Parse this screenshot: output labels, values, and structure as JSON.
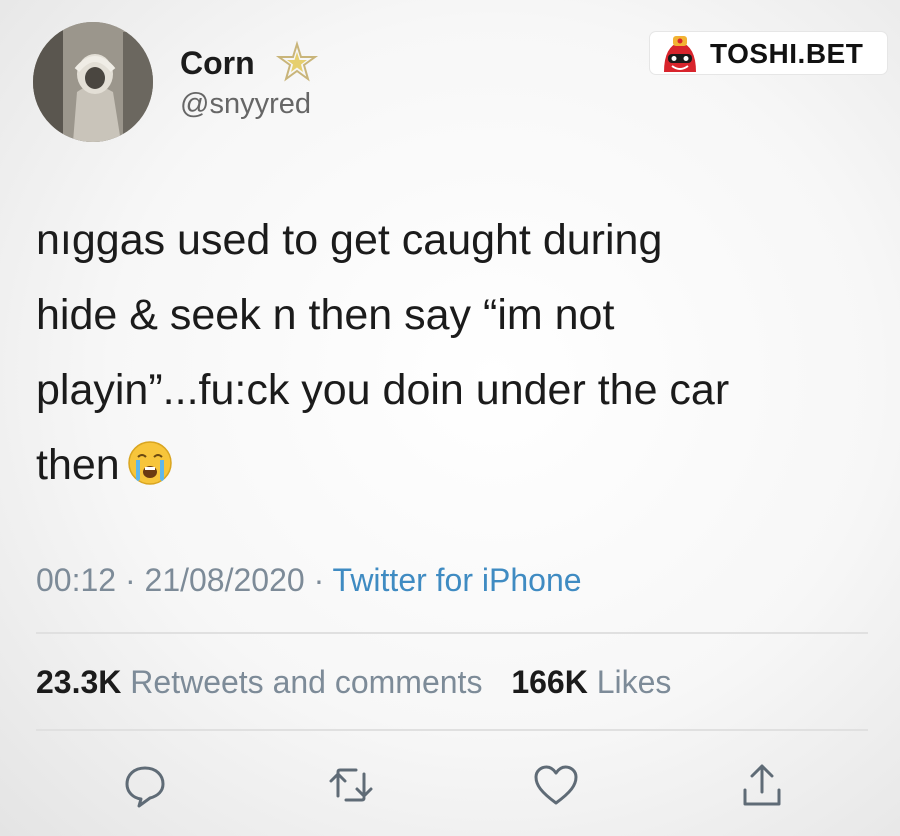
{
  "author": {
    "display_name": "Corn",
    "handle": "@snyyred"
  },
  "watermark": {
    "text": "TOSHI.BET"
  },
  "tweet": {
    "lines": [
      "nıggas used to get caught during",
      "hide & seek n then say “im not",
      "playin”...fu:ck you doin under the car",
      "then"
    ],
    "emoji": "crying-face"
  },
  "meta": {
    "time": "00:12",
    "date": "21/08/2020",
    "source": "Twitter for iPhone",
    "separator": "·"
  },
  "stats": {
    "retweets_count": "23.3K",
    "retweets_label": "Retweets and comments",
    "likes_count": "166K",
    "likes_label": "Likes"
  },
  "actions": [
    "reply",
    "retweet",
    "like",
    "share"
  ],
  "colors": {
    "link": "#3f8bc2",
    "muted": "#7d8b98",
    "brand_red": "#d8242c",
    "text": "#1b1b1b"
  }
}
